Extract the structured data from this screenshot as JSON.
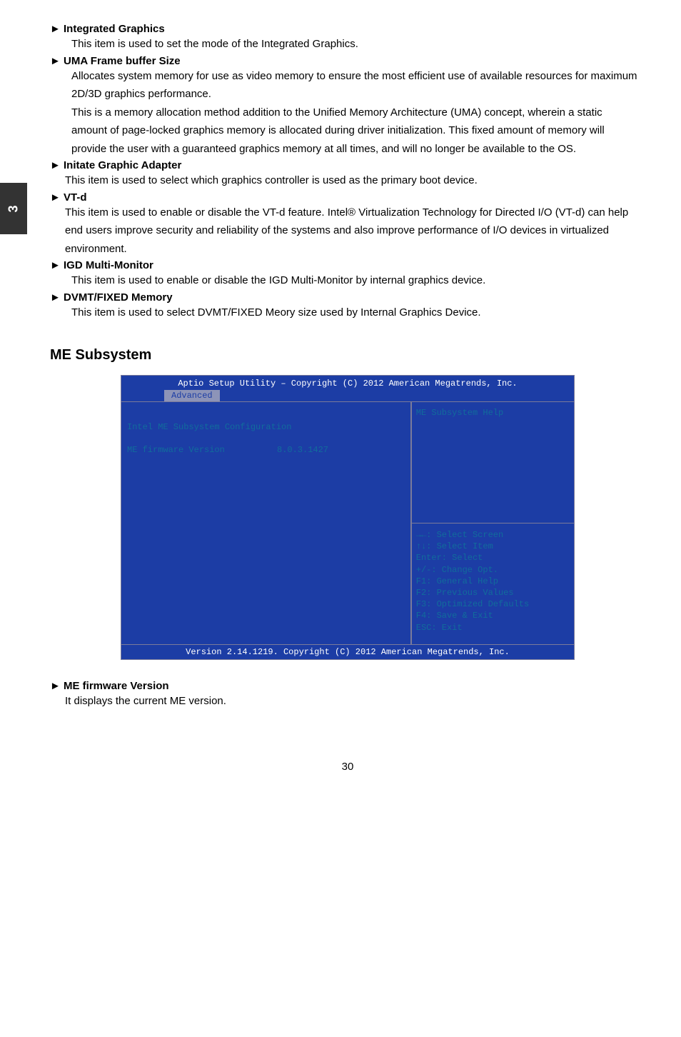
{
  "sideTab": "3",
  "items": {
    "ig": {
      "title": "► Integrated Graphics",
      "body": "This item is used to set the mode of the Integrated Graphics."
    },
    "uma": {
      "title": "► UMA Frame buffer Size",
      "body1": "Allocates system memory for use as video memory to ensure the most efficient use of available resources for maximum 2D/3D graphics performance.",
      "body2": "This is a memory allocation method addition to the Unified Memory Architecture (UMA) concept, wherein a static amount of page-locked graphics memory is allocated during driver initialization. This fixed amount of memory will provide the user with a guaranteed graphics memory at all times, and will no longer be available to the OS."
    },
    "initate": {
      "title": "► Initate Graphic Adapter",
      "body": "This item is used to select which graphics controller is used as the primary boot device."
    },
    "vtd": {
      "title": "► VT-d",
      "body": "This item is used to enable or disable the VT-d feature. Intel® Virtualization Technology for Directed I/O (VT-d) can help end users improve security and reliability of the systems and also improve performance of I/O devices in virtualized environment."
    },
    "igd": {
      "title": "► IGD Multi-Monitor",
      "body": "This item is used to enable or disable the IGD Multi-Monitor by internal graphics device."
    },
    "dvmt": {
      "title": "► DVMT/FIXED Memory",
      "body": "This item is used to select DVMT/FIXED Meory size used by Internal Graphics Device."
    }
  },
  "meHeading": "ME Subsystem",
  "bios": {
    "headerTitle": "Aptio Setup Utility – Copyright (C) 2012 American Megatrends, Inc.",
    "tab": "Advanced",
    "left": {
      "line1": "Intel ME Subsystem Configuration",
      "line2label": "ME firmware Version",
      "line2value": "8.0.3.1427"
    },
    "rightTop": "ME Subsystem Help",
    "rightBottom": {
      "l1": "→←: Select Screen",
      "l2": "↑↓: Select Item",
      "l3": "Enter: Select",
      "l4": "+/-: Change Opt.",
      "l5": "F1: General Help",
      "l6": "F2: Previous Values",
      "l7": "F3: Optimized Defaults",
      "l8": "F4: Save & Exit",
      "l9": "ESC: Exit"
    },
    "footer": "Version 2.14.1219. Copyright (C) 2012 American Megatrends, Inc."
  },
  "meFw": {
    "title": "► ME firmware Version",
    "body": "It displays the current ME version."
  },
  "pageNum": "30"
}
